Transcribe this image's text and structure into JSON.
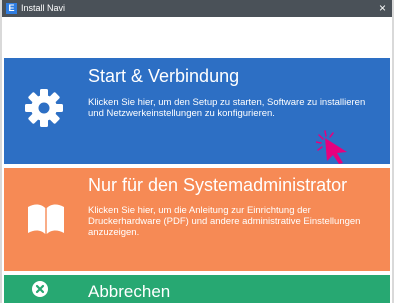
{
  "window": {
    "title": "Install Navi",
    "app_icon_letter": "E",
    "close_symbol": "×"
  },
  "start": {
    "heading": "Start & Verbindung",
    "description": "Klicken Sie hier, um den Setup zu starten, Software zu installieren und Netzwerkeinstellungen zu konfigurieren.",
    "icon": "gear-icon",
    "color": "#2d6fc4"
  },
  "admin": {
    "heading": "Nur für den Systemadministrator",
    "description": "Klicken Sie hier, um die Anleitung zur Einrichtung der Druckerhardware (PDF) und andere administrative Einstellungen anzuzeigen.",
    "icon": "book-icon",
    "color": "#f68a55"
  },
  "cancel": {
    "heading": "Abbrechen",
    "icon": "close-circle-icon",
    "color": "#27a872"
  },
  "cursor": {
    "icon": "pointer-cursor-icon",
    "color": "#e6007e"
  }
}
